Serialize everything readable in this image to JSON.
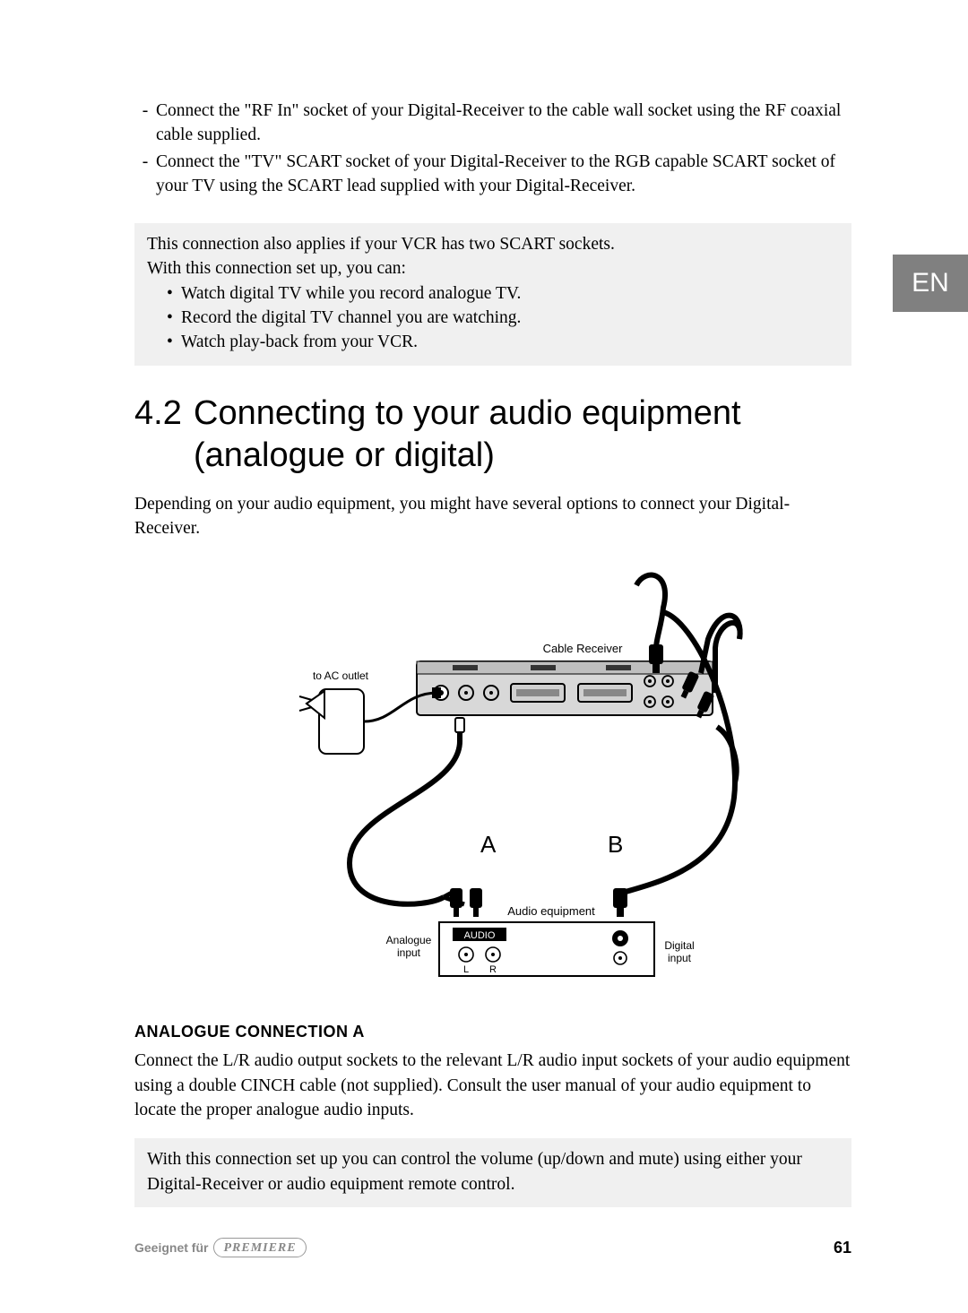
{
  "lang_tab": "EN",
  "top_bullets": [
    "Connect the \"RF In\" socket of your Digital-Receiver to the cable wall socket using the RF coaxial cable supplied.",
    "Connect the \"TV\" SCART socket of your Digital-Receiver to the RGB capable SCART socket of your TV using the SCART lead supplied with your Digital-Receiver."
  ],
  "info_box": {
    "line1": "This connection also applies if your VCR has two SCART sockets.",
    "line2": "With this connection set up, you can:",
    "sub_bullets": [
      "Watch digital TV while you record analogue TV.",
      "Record the digital TV channel you are watching.",
      "Watch play-back from your VCR."
    ]
  },
  "section": {
    "number": "4.2",
    "title": "Connecting to your audio equipment (analogue or digital)",
    "intro": "Depending on your audio equipment, you might have several options to connect your Digital-Receiver."
  },
  "diagram": {
    "cable_receiver": "Cable Receiver",
    "to_ac_outlet": "to AC outlet",
    "label_a": "A",
    "label_b": "B",
    "audio_equipment": "Audio equipment",
    "audio": "AUDIO",
    "analogue_input": "Analogue\ninput",
    "digital_input": "Digital\ninput",
    "l": "L",
    "r": "R"
  },
  "analogue": {
    "heading": "ANALOGUE CONNECTION A",
    "para": "Connect the L/R audio output sockets to the relevant L/R audio input sockets of your audio equipment using a double CINCH cable (not supplied). Consult the user manual of your audio equipment to locate the proper analogue audio inputs.",
    "box": "With this connection set up you can control the volume (up/down and mute) using either your Digital-Receiver or audio equipment remote control."
  },
  "footer": {
    "geeignet": "Geeignet für",
    "premiere": "PREMIERE",
    "page": "61"
  }
}
